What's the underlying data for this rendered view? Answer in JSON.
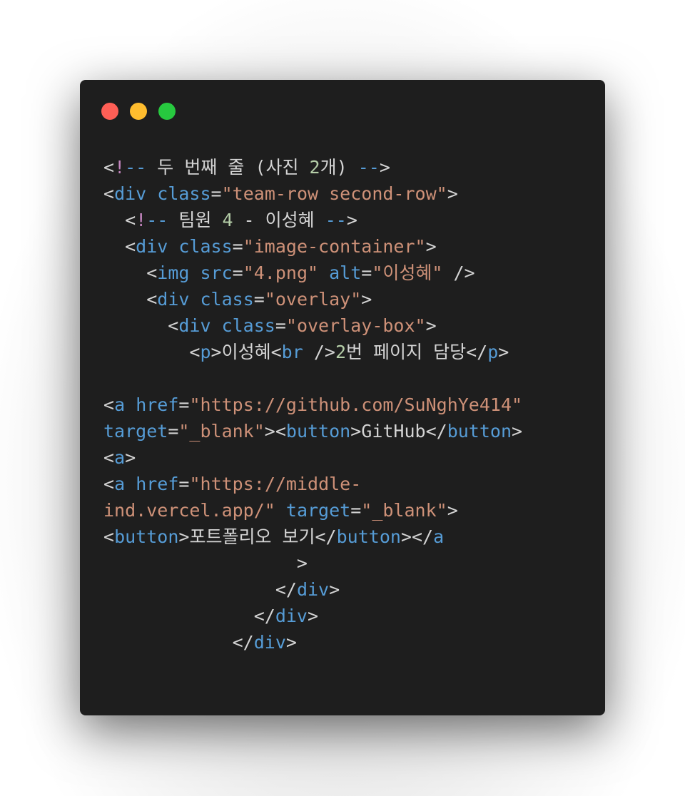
{
  "window": {
    "controls": {
      "close_color": "#ff5f56",
      "minimize_color": "#ffbd2e",
      "maximize_color": "#27c93f"
    }
  },
  "code_lines": [
    [
      {
        "k": "p",
        "t": "<"
      },
      {
        "k": "bang",
        "t": "!"
      },
      {
        "k": "dash",
        "t": "--"
      },
      {
        "k": "txt",
        "t": " 두 번째 줄 (사진 "
      },
      {
        "k": "num",
        "t": "2"
      },
      {
        "k": "txt",
        "t": "개) "
      },
      {
        "k": "dash",
        "t": "--"
      },
      {
        "k": "p",
        "t": ">"
      }
    ],
    [
      {
        "k": "p",
        "t": "<"
      },
      {
        "k": "t",
        "t": "div"
      },
      {
        "k": "p",
        "t": " "
      },
      {
        "k": "a",
        "t": "class"
      },
      {
        "k": "p",
        "t": "="
      },
      {
        "k": "s",
        "t": "\"team-row second-row\""
      },
      {
        "k": "p",
        "t": ">"
      }
    ],
    [
      {
        "k": "p",
        "t": "  <"
      },
      {
        "k": "bang",
        "t": "!"
      },
      {
        "k": "dash",
        "t": "--"
      },
      {
        "k": "txt",
        "t": " 팀원 "
      },
      {
        "k": "num",
        "t": "4"
      },
      {
        "k": "txt",
        "t": " - 이성혜 "
      },
      {
        "k": "dash",
        "t": "--"
      },
      {
        "k": "p",
        "t": ">"
      }
    ],
    [
      {
        "k": "p",
        "t": "  <"
      },
      {
        "k": "t",
        "t": "div"
      },
      {
        "k": "p",
        "t": " "
      },
      {
        "k": "a",
        "t": "class"
      },
      {
        "k": "p",
        "t": "="
      },
      {
        "k": "s",
        "t": "\"image-container\""
      },
      {
        "k": "p",
        "t": ">"
      }
    ],
    [
      {
        "k": "p",
        "t": "    <"
      },
      {
        "k": "t",
        "t": "img"
      },
      {
        "k": "p",
        "t": " "
      },
      {
        "k": "a",
        "t": "src"
      },
      {
        "k": "p",
        "t": "="
      },
      {
        "k": "s",
        "t": "\"4.png\""
      },
      {
        "k": "p",
        "t": " "
      },
      {
        "k": "a",
        "t": "alt"
      },
      {
        "k": "p",
        "t": "="
      },
      {
        "k": "s",
        "t": "\"이성혜\""
      },
      {
        "k": "p",
        "t": " />"
      }
    ],
    [
      {
        "k": "p",
        "t": "    <"
      },
      {
        "k": "t",
        "t": "div"
      },
      {
        "k": "p",
        "t": " "
      },
      {
        "k": "a",
        "t": "class"
      },
      {
        "k": "p",
        "t": "="
      },
      {
        "k": "s",
        "t": "\"overlay\""
      },
      {
        "k": "p",
        "t": ">"
      }
    ],
    [
      {
        "k": "p",
        "t": "      <"
      },
      {
        "k": "t",
        "t": "div"
      },
      {
        "k": "p",
        "t": " "
      },
      {
        "k": "a",
        "t": "class"
      },
      {
        "k": "p",
        "t": "="
      },
      {
        "k": "s",
        "t": "\"overlay-box\""
      },
      {
        "k": "p",
        "t": ">"
      }
    ],
    [
      {
        "k": "p",
        "t": "        <"
      },
      {
        "k": "t",
        "t": "p"
      },
      {
        "k": "p",
        "t": ">"
      },
      {
        "k": "txt",
        "t": "이성혜"
      },
      {
        "k": "p",
        "t": "<"
      },
      {
        "k": "t",
        "t": "br"
      },
      {
        "k": "p",
        "t": " />"
      },
      {
        "k": "num",
        "t": "2"
      },
      {
        "k": "txt",
        "t": "번 페이지 담당"
      },
      {
        "k": "p",
        "t": "</"
      },
      {
        "k": "t",
        "t": "p"
      },
      {
        "k": "p",
        "t": ">"
      }
    ],
    [],
    [
      {
        "k": "p",
        "t": "<"
      },
      {
        "k": "t",
        "t": "a"
      },
      {
        "k": "p",
        "t": " "
      },
      {
        "k": "a",
        "t": "href"
      },
      {
        "k": "p",
        "t": "="
      },
      {
        "k": "s",
        "t": "\"https://github.com/SuNghYe414\""
      }
    ],
    [
      {
        "k": "a",
        "t": "target"
      },
      {
        "k": "p",
        "t": "="
      },
      {
        "k": "s",
        "t": "\"_blank\""
      },
      {
        "k": "p",
        "t": "><"
      },
      {
        "k": "t",
        "t": "button"
      },
      {
        "k": "p",
        "t": ">"
      },
      {
        "k": "txt",
        "t": "GitHub"
      },
      {
        "k": "p",
        "t": "</"
      },
      {
        "k": "t",
        "t": "button"
      },
      {
        "k": "p",
        "t": ">"
      }
    ],
    [
      {
        "k": "p",
        "t": "<"
      },
      {
        "k": "t",
        "t": "a"
      },
      {
        "k": "p",
        "t": ">"
      }
    ],
    [
      {
        "k": "p",
        "t": "<"
      },
      {
        "k": "t",
        "t": "a"
      },
      {
        "k": "p",
        "t": " "
      },
      {
        "k": "a",
        "t": "href"
      },
      {
        "k": "p",
        "t": "="
      },
      {
        "k": "s",
        "t": "\"https://middle-"
      }
    ],
    [
      {
        "k": "s",
        "t": "ind.vercel.app/\""
      },
      {
        "k": "p",
        "t": " "
      },
      {
        "k": "a",
        "t": "target"
      },
      {
        "k": "p",
        "t": "="
      },
      {
        "k": "s",
        "t": "\"_blank\""
      },
      {
        "k": "p",
        "t": ">"
      }
    ],
    [
      {
        "k": "p",
        "t": "<"
      },
      {
        "k": "t",
        "t": "button"
      },
      {
        "k": "p",
        "t": ">"
      },
      {
        "k": "txt",
        "t": "포트폴리오 보기"
      },
      {
        "k": "p",
        "t": "</"
      },
      {
        "k": "t",
        "t": "button"
      },
      {
        "k": "p",
        "t": "></"
      },
      {
        "k": "t",
        "t": "a"
      }
    ],
    [
      {
        "k": "p",
        "t": "                  >"
      }
    ],
    [
      {
        "k": "p",
        "t": "                </"
      },
      {
        "k": "t",
        "t": "div"
      },
      {
        "k": "p",
        "t": ">"
      }
    ],
    [
      {
        "k": "p",
        "t": "              </"
      },
      {
        "k": "t",
        "t": "div"
      },
      {
        "k": "p",
        "t": ">"
      }
    ],
    [
      {
        "k": "p",
        "t": "            </"
      },
      {
        "k": "t",
        "t": "div"
      },
      {
        "k": "p",
        "t": ">"
      }
    ]
  ]
}
